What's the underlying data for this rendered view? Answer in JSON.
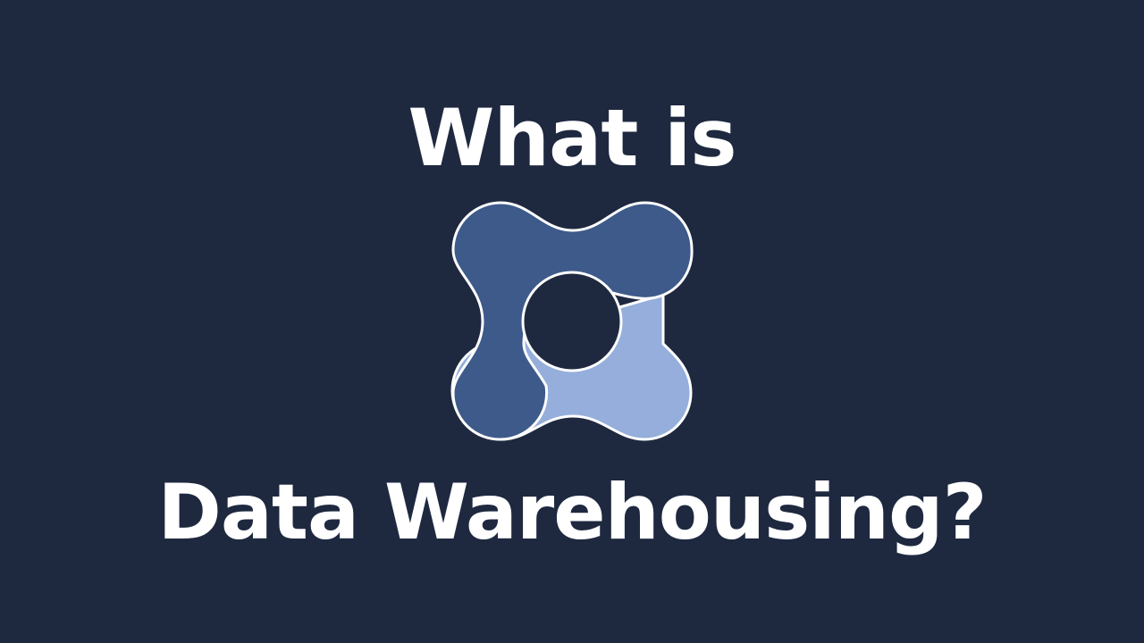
{
  "slide": {
    "title_line_1": "What is",
    "title_line_2": "Data Warehousing?",
    "background_color": "#1e2940",
    "text_color": "#ffffff"
  },
  "logo": {
    "icon": "data-warehouse-logo-icon",
    "dark_shape_color": "#3d5a8a",
    "light_shape_color": "#95aedb",
    "outline_color": "#ffffff"
  }
}
